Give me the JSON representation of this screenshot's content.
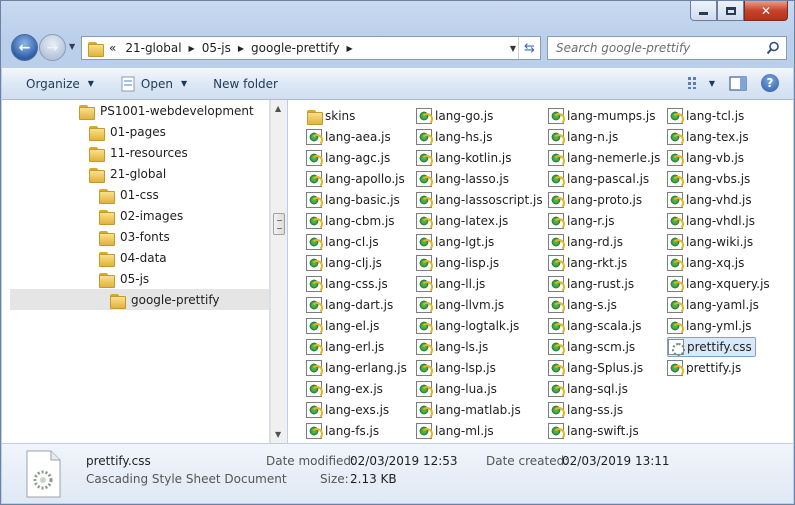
{
  "window": {
    "caption_buttons": {
      "minimize": "minimize-icon",
      "maximize": "maximize-icon",
      "close": "close-icon"
    }
  },
  "address": {
    "overflow": "«",
    "crumbs": [
      "21-global",
      "05-js",
      "google-prettify"
    ],
    "refresh_icon": "refresh-icon"
  },
  "search": {
    "placeholder": "Search google-prettify"
  },
  "toolbar": {
    "organize": "Organize",
    "open": "Open",
    "new_folder": "New folder"
  },
  "tree": [
    {
      "label": "PS1001-webdevelopment",
      "level": 0
    },
    {
      "label": "01-pages",
      "level": 1
    },
    {
      "label": "11-resources",
      "level": 1
    },
    {
      "label": "21-global",
      "level": 1
    },
    {
      "label": "01-css",
      "level": 2
    },
    {
      "label": "02-images",
      "level": 2
    },
    {
      "label": "03-fonts",
      "level": 2
    },
    {
      "label": "04-data",
      "level": 2
    },
    {
      "label": "05-js",
      "level": 2
    },
    {
      "label": "google-prettify",
      "level": 3,
      "selected": true
    }
  ],
  "files": [
    {
      "name": "skins",
      "type": "folder"
    },
    {
      "name": "lang-aea.js",
      "type": "js"
    },
    {
      "name": "lang-agc.js",
      "type": "js"
    },
    {
      "name": "lang-apollo.js",
      "type": "js"
    },
    {
      "name": "lang-basic.js",
      "type": "js"
    },
    {
      "name": "lang-cbm.js",
      "type": "js"
    },
    {
      "name": "lang-cl.js",
      "type": "js"
    },
    {
      "name": "lang-clj.js",
      "type": "js"
    },
    {
      "name": "lang-css.js",
      "type": "js"
    },
    {
      "name": "lang-dart.js",
      "type": "js"
    },
    {
      "name": "lang-el.js",
      "type": "js"
    },
    {
      "name": "lang-erl.js",
      "type": "js"
    },
    {
      "name": "lang-erlang.js",
      "type": "js"
    },
    {
      "name": "lang-ex.js",
      "type": "js"
    },
    {
      "name": "lang-exs.js",
      "type": "js"
    },
    {
      "name": "lang-fs.js",
      "type": "js"
    },
    {
      "name": "lang-go.js",
      "type": "js"
    },
    {
      "name": "lang-hs.js",
      "type": "js"
    },
    {
      "name": "lang-kotlin.js",
      "type": "js"
    },
    {
      "name": "lang-lasso.js",
      "type": "js"
    },
    {
      "name": "lang-lassoscript.js",
      "type": "js"
    },
    {
      "name": "lang-latex.js",
      "type": "js"
    },
    {
      "name": "lang-lgt.js",
      "type": "js"
    },
    {
      "name": "lang-lisp.js",
      "type": "js"
    },
    {
      "name": "lang-ll.js",
      "type": "js"
    },
    {
      "name": "lang-llvm.js",
      "type": "js"
    },
    {
      "name": "lang-logtalk.js",
      "type": "js"
    },
    {
      "name": "lang-ls.js",
      "type": "js"
    },
    {
      "name": "lang-lsp.js",
      "type": "js"
    },
    {
      "name": "lang-lua.js",
      "type": "js"
    },
    {
      "name": "lang-matlab.js",
      "type": "js"
    },
    {
      "name": "lang-ml.js",
      "type": "js"
    },
    {
      "name": "lang-mumps.js",
      "type": "js"
    },
    {
      "name": "lang-n.js",
      "type": "js"
    },
    {
      "name": "lang-nemerle.js",
      "type": "js"
    },
    {
      "name": "lang-pascal.js",
      "type": "js"
    },
    {
      "name": "lang-proto.js",
      "type": "js"
    },
    {
      "name": "lang-r.js",
      "type": "js"
    },
    {
      "name": "lang-rd.js",
      "type": "js"
    },
    {
      "name": "lang-rkt.js",
      "type": "js"
    },
    {
      "name": "lang-rust.js",
      "type": "js"
    },
    {
      "name": "lang-s.js",
      "type": "js"
    },
    {
      "name": "lang-scala.js",
      "type": "js"
    },
    {
      "name": "lang-scm.js",
      "type": "js"
    },
    {
      "name": "lang-Splus.js",
      "type": "js"
    },
    {
      "name": "lang-sql.js",
      "type": "js"
    },
    {
      "name": "lang-ss.js",
      "type": "js"
    },
    {
      "name": "lang-swift.js",
      "type": "js"
    },
    {
      "name": "lang-tcl.js",
      "type": "js"
    },
    {
      "name": "lang-tex.js",
      "type": "js"
    },
    {
      "name": "lang-vb.js",
      "type": "js"
    },
    {
      "name": "lang-vbs.js",
      "type": "js"
    },
    {
      "name": "lang-vhd.js",
      "type": "js"
    },
    {
      "name": "lang-vhdl.js",
      "type": "js"
    },
    {
      "name": "lang-wiki.js",
      "type": "js"
    },
    {
      "name": "lang-xq.js",
      "type": "js"
    },
    {
      "name": "lang-xquery.js",
      "type": "js"
    },
    {
      "name": "lang-yaml.js",
      "type": "js"
    },
    {
      "name": "lang-yml.js",
      "type": "js"
    },
    {
      "name": "prettify.css",
      "type": "css",
      "selected": true
    },
    {
      "name": "prettify.js",
      "type": "js"
    }
  ],
  "details": {
    "name": "prettify.css",
    "type": "Cascading Style Sheet Document",
    "modified_label": "Date modified:",
    "modified": "02/03/2019 12:53",
    "created_label": "Date created:",
    "created": "02/03/2019 13:11",
    "size_label": "Size:",
    "size": "2.13 KB"
  },
  "colors": {
    "accent": "#3a6bbd",
    "selection": "#dbe8f8",
    "frame": "#bcd0ea"
  }
}
